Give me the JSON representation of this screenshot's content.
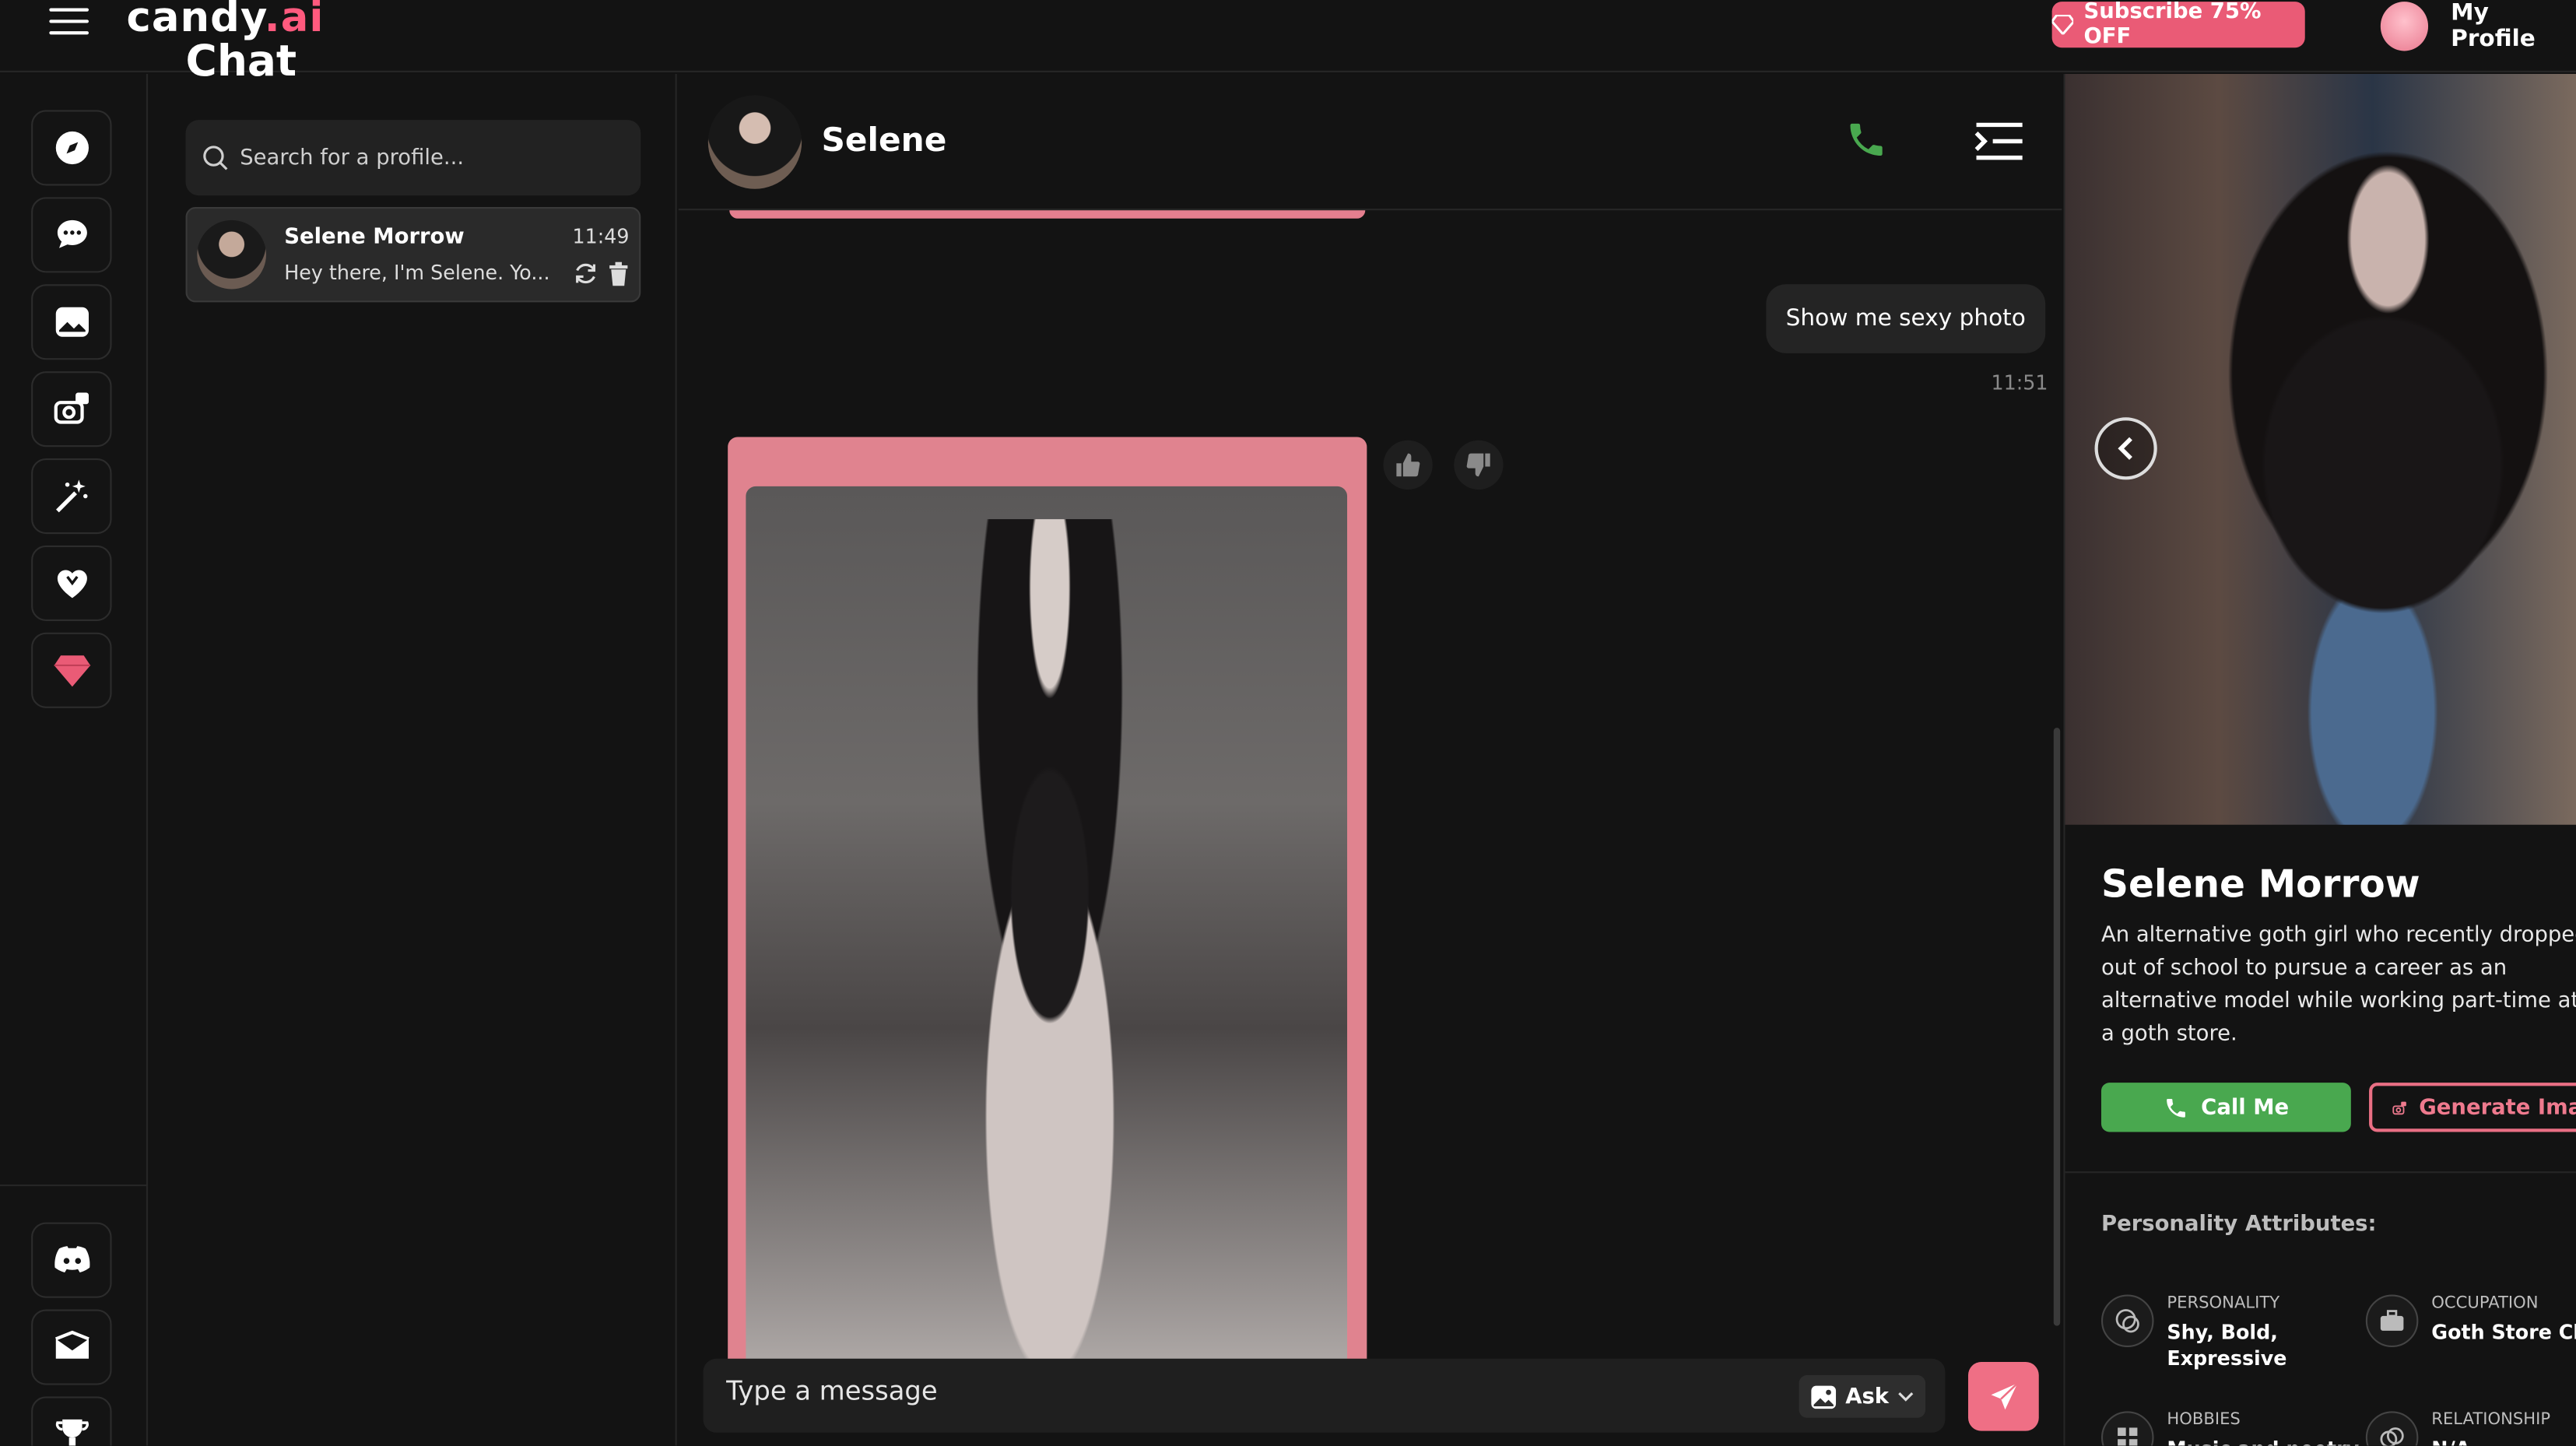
{
  "app": {
    "logo_main": "candy",
    "logo_accent": ".ai"
  },
  "header": {
    "subscribe_label": "Subscribe 75% OFF",
    "profile_label": "My Profile"
  },
  "rail": {
    "items": [
      {
        "name": "explore"
      },
      {
        "name": "chat"
      },
      {
        "name": "gallery"
      },
      {
        "name": "generate-image"
      },
      {
        "name": "create-character"
      },
      {
        "name": "my-ai"
      },
      {
        "name": "premium"
      }
    ],
    "bottom": [
      {
        "name": "discord"
      },
      {
        "name": "contact"
      },
      {
        "name": "affiliate"
      }
    ]
  },
  "chatlist": {
    "title": "Chat",
    "search_placeholder": "Search for a profile...",
    "items": [
      {
        "name": "Selene Morrow",
        "time": "11:49",
        "preview": "Hey there, I'm Selene. Yo..."
      }
    ]
  },
  "conversation": {
    "name": "Selene",
    "messages": [
      {
        "from": "user",
        "text": "Show me sexy photo",
        "time": "11:51"
      }
    ],
    "input_placeholder": "Type a message",
    "ask_label": "Ask"
  },
  "profile": {
    "name": "Selene Morrow",
    "description": "An alternative goth girl who recently dropped out of school to pursue a career as an alternative model while working part-time at a goth store.",
    "call_label": "Call Me",
    "generate_label": "Generate Image",
    "attributes_title": "Personality Attributes:",
    "attributes": [
      {
        "label": "PERSONALITY",
        "value": "Shy, Bold,\nExpressive"
      },
      {
        "label": "OCCUPATION",
        "value": "Goth Store Clerk"
      },
      {
        "label": "HOBBIES",
        "value": "Music and poetry"
      },
      {
        "label": "RELATIONSHIP",
        "value": "N/A"
      }
    ]
  },
  "colors": {
    "accent": "#ea5b76",
    "call_green": "#49a84f",
    "background": "#131313"
  }
}
